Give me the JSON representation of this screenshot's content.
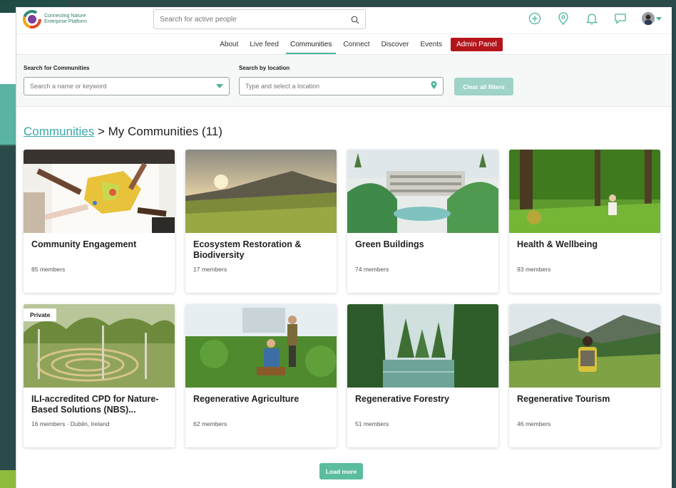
{
  "logo": {
    "line1": "Connecting Nature",
    "line2": "Enterprise Platform"
  },
  "search": {
    "placeholder": "Search for active people"
  },
  "nav": {
    "items": [
      "About",
      "Live feed",
      "Communities",
      "Connect",
      "Discover",
      "Events"
    ],
    "active": "Communities",
    "admin_label": "Admin Panel"
  },
  "filters": {
    "communities_label": "Search for Communities",
    "communities_placeholder": "Search a name or keyword",
    "location_label": "Search by location",
    "location_placeholder": "Type and select a location",
    "clear_label": "Clear all filters"
  },
  "breadcrumb": {
    "root": "Communities",
    "sep": ">",
    "current": "My Communities (11)"
  },
  "cards": [
    {
      "title": "Community Engagement",
      "meta": "85 members",
      "private": false
    },
    {
      "title": "Ecosystem Restoration & Biodiversity",
      "meta": "17 members",
      "private": false
    },
    {
      "title": "Green Buildings",
      "meta": "74 members",
      "private": false
    },
    {
      "title": "Health & Wellbeing",
      "meta": "93 members",
      "private": false
    },
    {
      "title": "ILI-accredited CPD for Nature-Based Solutions (NBS)...",
      "meta": "16 members · Dublin, Ireland",
      "private": true,
      "badge": "Private"
    },
    {
      "title": "Regenerative Agriculture",
      "meta": "62 members",
      "private": false
    },
    {
      "title": "Regenerative Forestry",
      "meta": "51 members",
      "private": false
    },
    {
      "title": "Regenerative Tourism",
      "meta": "46 members",
      "private": false
    }
  ],
  "load_more": "Load more",
  "colors": {
    "accent": "#4bb39b",
    "admin": "#b3151b",
    "link": "#3aa6a8"
  }
}
